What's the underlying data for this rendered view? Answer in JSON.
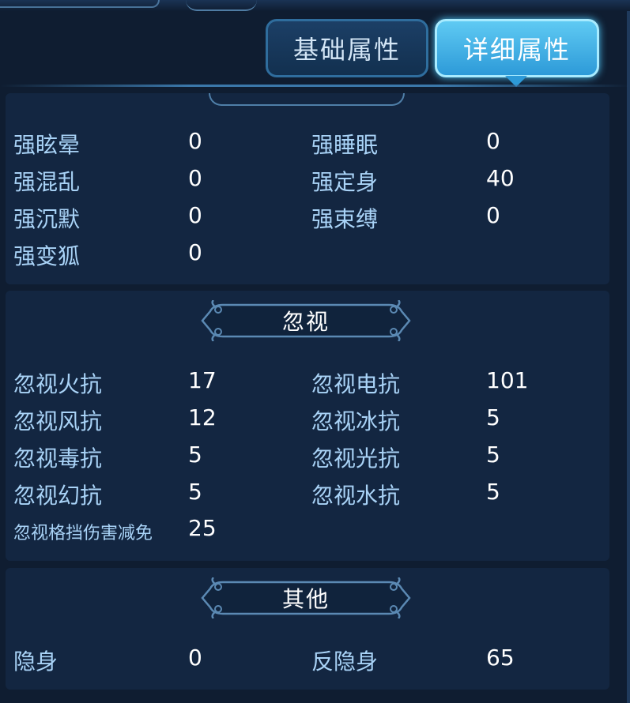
{
  "tabs": {
    "basic": "基础属性",
    "detail": "详细属性"
  },
  "section_control": {
    "rows": [
      {
        "left_label": "强眩晕",
        "left_value": "0",
        "right_label": "强睡眠",
        "right_value": "0"
      },
      {
        "left_label": "强混乱",
        "left_value": "0",
        "right_label": "强定身",
        "right_value": "40"
      },
      {
        "left_label": "强沉默",
        "left_value": "0",
        "right_label": "强束缚",
        "right_value": "0"
      },
      {
        "left_label": "强变狐",
        "left_value": "0"
      }
    ]
  },
  "section_ignore": {
    "title": "忽视",
    "rows": [
      {
        "left_label": "忽视火抗",
        "left_value": "17",
        "right_label": "忽视电抗",
        "right_value": "101"
      },
      {
        "left_label": "忽视风抗",
        "left_value": "12",
        "right_label": "忽视冰抗",
        "right_value": "5"
      },
      {
        "left_label": "忽视毒抗",
        "left_value": "5",
        "right_label": "忽视光抗",
        "right_value": "5"
      },
      {
        "left_label": "忽视幻抗",
        "left_value": "5",
        "right_label": "忽视水抗",
        "right_value": "5"
      },
      {
        "left_label": "忽视格挡伤害减免",
        "left_value": "25"
      }
    ]
  },
  "section_other": {
    "title": "其他",
    "rows": [
      {
        "left_label": "隐身",
        "left_value": "0",
        "right_label": "反隐身",
        "right_value": "65"
      }
    ]
  },
  "colors": {
    "label": "#a9d3f7",
    "value": "#ffffff",
    "panel": "#132641",
    "active_tab": "#2d9ad8"
  }
}
